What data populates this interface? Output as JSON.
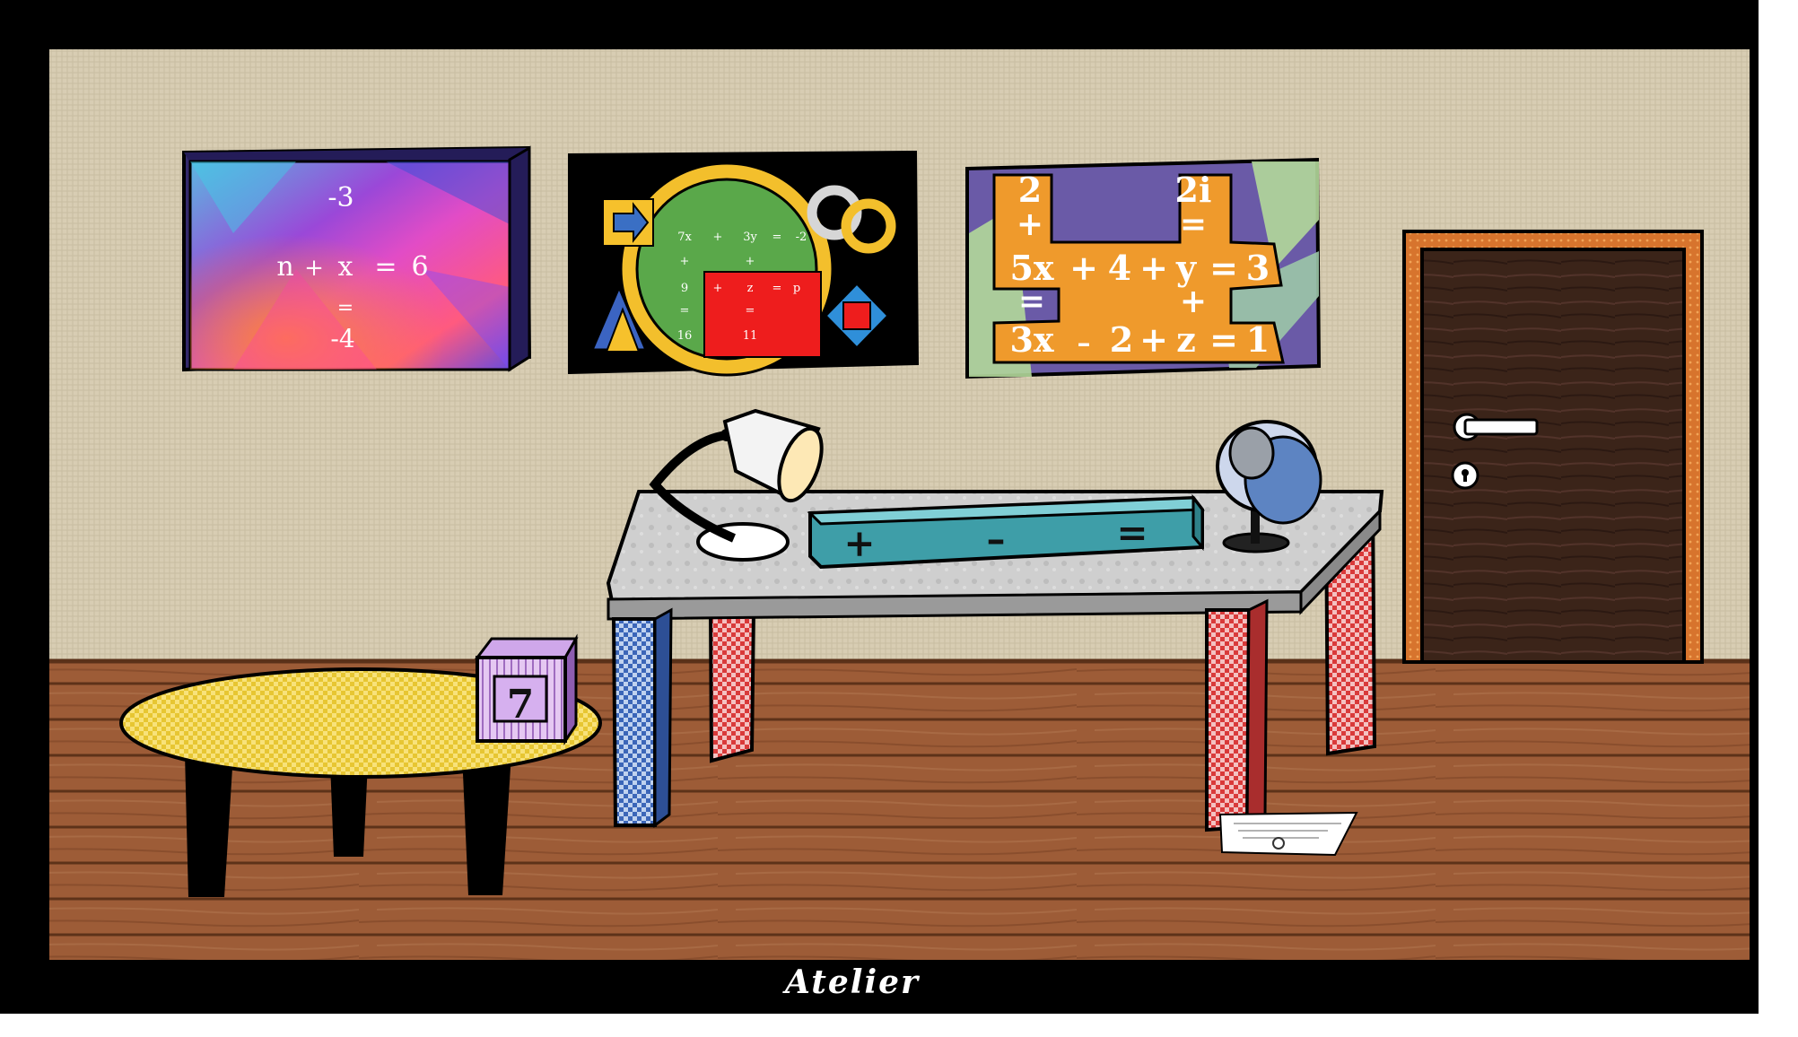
{
  "room": {
    "name": "Atelier"
  },
  "painting_left": {
    "top": "-3",
    "middle": [
      "n",
      "+",
      "x",
      "=",
      "6"
    ],
    "eq_sign": "=",
    "bottom": "-4"
  },
  "painting_middle": {
    "grid": [
      [
        "7x",
        "+",
        "3y",
        "=",
        "-2"
      ],
      [
        "+",
        "",
        "+",
        "",
        ""
      ],
      [
        "9",
        "+",
        "z",
        "=",
        "p"
      ],
      [
        "=",
        "",
        "=",
        "",
        ""
      ],
      [
        "16",
        "",
        "11",
        "",
        ""
      ]
    ]
  },
  "painting_right": {
    "lines": [
      [
        "2",
        "",
        "",
        "",
        "",
        "2i",
        "",
        ""
      ],
      [
        "+",
        "",
        "",
        "",
        "",
        "=",
        "",
        ""
      ],
      [
        "5x",
        "+",
        "4",
        "+",
        "y",
        "=",
        "3",
        ""
      ],
      [
        "=",
        "",
        "",
        "",
        "",
        "+",
        "",
        ""
      ],
      [
        "3x",
        "–",
        "2",
        "+",
        "z",
        "=",
        "1",
        ""
      ]
    ]
  },
  "desk_box": {
    "symbols": [
      "+",
      "–",
      "="
    ]
  },
  "cube": {
    "number": "7"
  },
  "colors": {
    "wall": "#d9cfb6",
    "floor": "#9c5a35",
    "frame": "#000000",
    "desk_top": "#c9c9c9",
    "box": "#4fb2bb",
    "table_top": "#f5d33c",
    "door": "#3a2418",
    "door_frame": "#d9772a"
  },
  "icons": [
    "lamp-icon",
    "globe-icon",
    "door-handle-icon",
    "keyhole-icon",
    "note-icon"
  ]
}
